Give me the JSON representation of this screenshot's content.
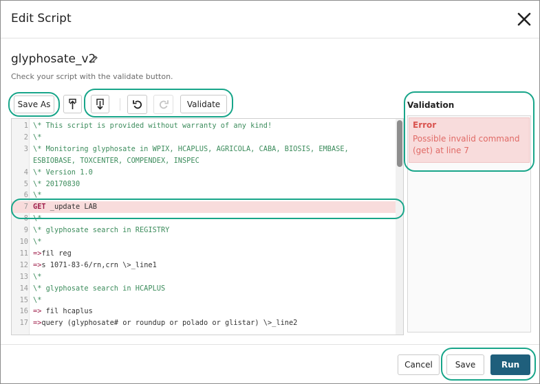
{
  "dialog": {
    "title": "Edit Script",
    "close_icon": "close-icon"
  },
  "script": {
    "name": "glyphosate_v2",
    "hint": "Check your script with the validate button."
  },
  "toolbar": {
    "save_as_label": "Save As",
    "upload_icon": "upload-icon",
    "download_icon": "download-icon",
    "undo_icon": "undo-icon",
    "redo_icon": "redo-icon",
    "validate_label": "Validate"
  },
  "editor": {
    "lines": [
      {
        "num": "1",
        "text": "\\* This script is provided without warranty of any kind!"
      },
      {
        "num": "2",
        "text": "\\*"
      },
      {
        "num": "3",
        "text": "\\* Monitoring glyphosate in WPIX, HCAPLUS, AGRICOLA, CABA, BIOSIS, EMBASE,"
      },
      {
        "num": "",
        "text": "ESBIOBASE, TOXCENTER, COMPENDEX, INSPEC"
      },
      {
        "num": "4",
        "text": "\\* Version 1.0"
      },
      {
        "num": "5",
        "text": "\\* 20170830"
      },
      {
        "num": "6",
        "text": "\\*"
      },
      {
        "num": "7",
        "kw": "GET",
        "text": " _update LAB"
      },
      {
        "num": "8",
        "text": "\\*"
      },
      {
        "num": "9",
        "text": "\\* glyphosate search in REGISTRY"
      },
      {
        "num": "10",
        "text": "\\*"
      },
      {
        "num": "11",
        "op": "=>",
        "text": "fil reg"
      },
      {
        "num": "12",
        "op": "=>",
        "text": "s 1071-83-6/rn,crn \\>_line1"
      },
      {
        "num": "13",
        "text": "\\*"
      },
      {
        "num": "14",
        "text": "\\* glyphosate search in HCAPLUS"
      },
      {
        "num": "15",
        "text": "\\*"
      },
      {
        "num": "16",
        "op": "=>",
        "text": " fil hcaplus"
      },
      {
        "num": "17",
        "op": "=>",
        "text": "query (glyphosate# or roundup or polado or glistar) \\>_line2"
      }
    ]
  },
  "validation": {
    "title": "Validation",
    "error_title": "Error",
    "error_message_1": "Possible invalid command",
    "error_message_2": "(get) at line 7"
  },
  "footer": {
    "cancel_label": "Cancel",
    "save_label": "Save",
    "run_label": "Run"
  },
  "colors": {
    "accent_ring": "#17a589",
    "primary_button": "#1f5f7c",
    "error_bg": "#f8dcdc",
    "error_text": "#d9534f"
  }
}
